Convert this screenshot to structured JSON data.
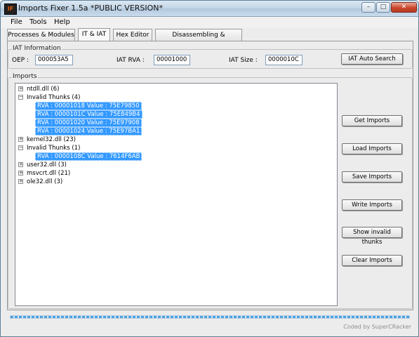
{
  "window": {
    "title": "Imports Fixer 1.5a *PUBLIC VERSION*",
    "icon_label": "IF"
  },
  "menu": [
    "File",
    "Tools",
    "Help"
  ],
  "tabs": [
    "Processes & Modules",
    "IT & IAT",
    "Hex Editor",
    "Disassembling & Debugging"
  ],
  "iat": {
    "legend": "IAT Information",
    "oep_label": "OEP :",
    "oep_value": "000053A5",
    "rva_label": "IAT RVA :",
    "rva_value": "00001000",
    "size_label": "IAT Size :",
    "size_value": "0000010C",
    "auto_search": "IAT Auto Search"
  },
  "imports": {
    "legend": "Imports",
    "rows": [
      {
        "label": "ntdll.dll (6)",
        "level": 0,
        "expander": "+",
        "selected": false
      },
      {
        "label": "Invalid Thunks (4)",
        "level": 0,
        "expander": "−",
        "selected": false
      },
      {
        "label": "RVA : 00001018 Value : 75E79850",
        "level": 1,
        "expander": "",
        "selected": true
      },
      {
        "label": "RVA : 0000101C Value : 75E849B4",
        "level": 1,
        "expander": "",
        "selected": true
      },
      {
        "label": "RVA : 00001020 Value : 75E97908",
        "level": 1,
        "expander": "",
        "selected": true
      },
      {
        "label": "RVA : 00001024 Value : 75E97BA1",
        "level": 1,
        "expander": "",
        "selected": true
      },
      {
        "label": "kernel32.dll (23)",
        "level": 0,
        "expander": "+",
        "selected": false
      },
      {
        "label": "Invalid Thunks (1)",
        "level": 0,
        "expander": "−",
        "selected": false
      },
      {
        "label": "RVA : 0000108C Value : 7614F6AB",
        "level": 1,
        "expander": "",
        "selected": true
      },
      {
        "label": "user32.dll (3)",
        "level": 0,
        "expander": "+",
        "selected": false
      },
      {
        "label": "msvcrt.dll (21)",
        "level": 0,
        "expander": "+",
        "selected": false
      },
      {
        "label": "ole32.dll (3)",
        "level": 0,
        "expander": "+",
        "selected": false
      }
    ],
    "buttons": [
      "Get Imports",
      "Load Imports",
      "Save Imports",
      "Write Imports",
      "Show invalid thunks",
      "Clear Imports"
    ]
  },
  "status_text": "Coded by SuperCRacker"
}
